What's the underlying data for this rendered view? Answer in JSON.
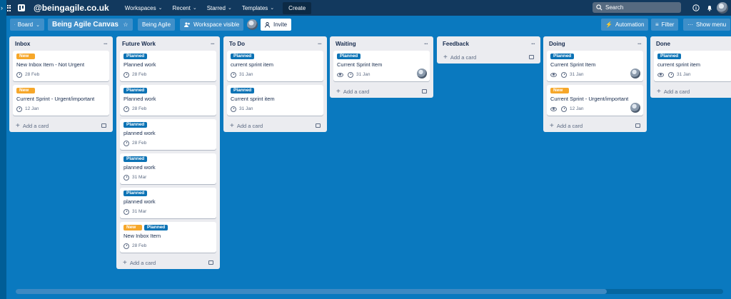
{
  "topbar": {
    "brand": "@beingagile.co.uk",
    "menus": [
      "Workspaces",
      "Recent",
      "Starred",
      "Templates"
    ],
    "create": "Create",
    "search_placeholder": "Search"
  },
  "boardbar": {
    "view": "Board",
    "title": "Being Agile Canvas",
    "workspace": "Being Agile",
    "visibility": "Workspace visible",
    "invite": "Invite",
    "automation": "Automation",
    "filter": "Filter",
    "show_menu": "Show menu"
  },
  "add_card_label": "Add a card",
  "lists": [
    {
      "name": "Inbox",
      "cards": [
        {
          "labels": [
            "New"
          ],
          "title": "New Inbox Item - Not Urgent",
          "date": "28 Feb"
        },
        {
          "labels": [
            "New"
          ],
          "title": "Current Sprint - Urgent/important",
          "date": "12 Jan"
        }
      ]
    },
    {
      "name": "Future Work",
      "cards": [
        {
          "labels": [
            "Planned"
          ],
          "title": "Planned work",
          "date": "28 Feb"
        },
        {
          "labels": [
            "Planned"
          ],
          "title": "Planned work",
          "date": "28 Feb"
        },
        {
          "labels": [
            "Planned"
          ],
          "title": "planned work",
          "date": "28 Feb"
        },
        {
          "labels": [
            "Planned"
          ],
          "title": "planned work",
          "date": "31 Mar"
        },
        {
          "labels": [
            "Planned"
          ],
          "title": "planned work",
          "date": "31 Mar"
        },
        {
          "labels": [
            "New",
            "Planned"
          ],
          "title": "New Inbox Item",
          "date": "28 Feb"
        }
      ]
    },
    {
      "name": "To Do",
      "cards": [
        {
          "labels": [
            "Planned"
          ],
          "title": "current sprint item",
          "date": "31 Jan"
        },
        {
          "labels": [
            "Planned"
          ],
          "title": "Current sprint item",
          "date": "31 Jan"
        }
      ]
    },
    {
      "name": "Waiting",
      "cards": [
        {
          "labels": [
            "Planned"
          ],
          "title": "Current Sprint Item",
          "date": "31 Jan"
        }
      ]
    },
    {
      "name": "Feedback",
      "cards": []
    },
    {
      "name": "Doing",
      "cards": [
        {
          "labels": [
            "Planned"
          ],
          "title": "Current Sprint Item",
          "date": "31 Jan"
        },
        {
          "labels": [
            "New"
          ],
          "title": "Current Sprint - Urgent/important",
          "date": "12 Jan"
        }
      ]
    },
    {
      "name": "Done",
      "cards": [
        {
          "labels": [
            "Planned"
          ],
          "title": "current sprint item",
          "date": "31 Jan"
        }
      ]
    }
  ],
  "colors": {
    "board": "#0a79bf",
    "topbar": "#12395e",
    "label_new": "#f6a72a",
    "label_planned": "#0c73b5"
  }
}
